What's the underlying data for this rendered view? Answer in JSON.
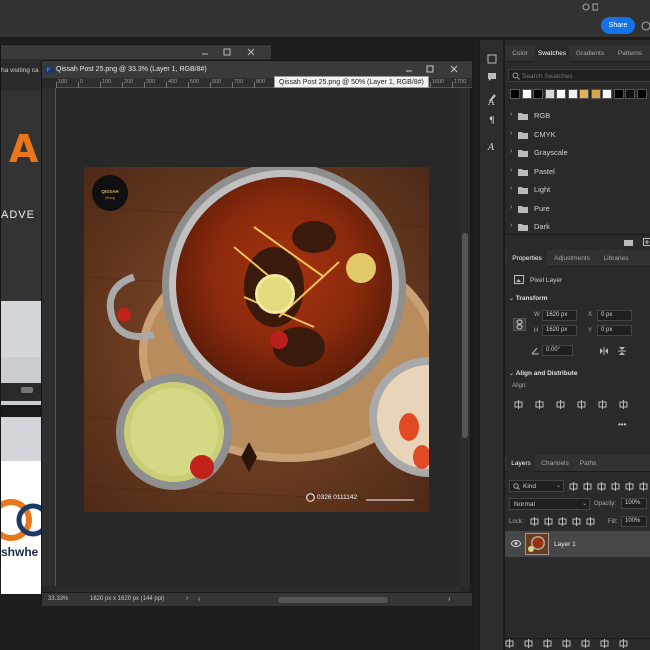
{
  "topbar": {
    "share_label": "Share"
  },
  "background_doc": {
    "tab_title": "ha visiting ca",
    "big_letter": "A",
    "text_fragment": "ADVE",
    "brand_fragment": "shwhe"
  },
  "document": {
    "tab_title": "Qissah Post 25.png @ 33.3% (Layer 1, RGB/8#)",
    "tooltip": "Qissah Post 25.png @ 50% (Layer 1, RGB/8#)",
    "ruler_ticks": [
      "100",
      "0",
      "100",
      "200",
      "300",
      "400",
      "500",
      "600",
      "700",
      "800",
      "900",
      "1000",
      "1100",
      "1200",
      "1300",
      "1400",
      "1500",
      "1600",
      "1700"
    ],
    "zoom": "33.33%",
    "doc_info": "1620 px x 1620 px (144 ppi)"
  },
  "canvas": {
    "logo_text": "QISSAH",
    "logo_tagline": "Dining",
    "phone": "0326 0111142"
  },
  "panels": {
    "swatch_tabs": [
      "Color",
      "Swatches",
      "Gradients",
      "Patterns"
    ],
    "swatch_tabs_active": 1,
    "search_placeholder": "Search Swatches",
    "swatch_colors": [
      "#000000",
      "#ffffff",
      "#000000",
      "#d9d9d9",
      "#ffffff",
      "#f2f2f2",
      "#e0b15a",
      "#d9a74a",
      "#ffffff",
      "#000000",
      "#111111",
      "#000000"
    ],
    "folders": [
      "RGB",
      "CMYK",
      "Grayscale",
      "Pastel",
      "Light",
      "Pure",
      "Dark"
    ],
    "props_tabs": [
      "Properties",
      "Adjustments",
      "Libraries"
    ],
    "layer_kind": "Pixel Layer",
    "transform": {
      "title": "Transform",
      "w_label": "W",
      "w": "1620 px",
      "h_label": "H",
      "h": "1620 px",
      "x_label": "X",
      "x": "0 px",
      "y_label": "Y",
      "y": "0 px",
      "angle": "0.00°"
    },
    "align": {
      "title": "Align and Distribute",
      "label": "Align:"
    },
    "layers_tabs": [
      "Layers",
      "Channels",
      "Paths"
    ],
    "layers": {
      "kind": "Kind",
      "blend_mode": "Normal",
      "opacity_label": "Opacity:",
      "opacity": "100%",
      "lock_label": "Lock:",
      "fill_label": "Fill:",
      "fill": "100%",
      "layer_name": "Layer 1"
    }
  }
}
